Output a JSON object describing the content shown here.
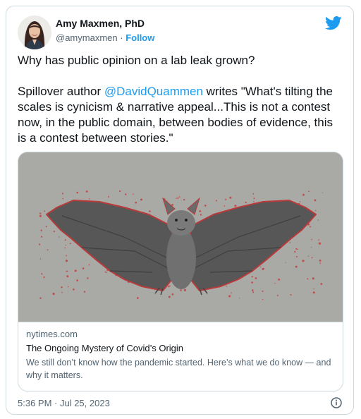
{
  "author": {
    "name": "Amy Maxmen, PhD",
    "handle": "@amymaxmen",
    "separator": "·",
    "follow_label": "Follow"
  },
  "tweet": {
    "line1": "Why has public opinion on a lab leak grown?",
    "prefix": "Spillover author ",
    "mention": "@DavidQuammen",
    "quote": " writes \"What's tilting the scales is cynicism & narrative appeal...This is not a contest now, in the public domain, between bodies of evidence, this is a contest between stories.\""
  },
  "link_card": {
    "domain": "nytimes.com",
    "title": "The Ongoing Mystery of Covid’s Origin",
    "description": "We still don’t know how the pandemic started. Here’s what we do know — and why it matters."
  },
  "timestamp": "5:36 PM · Jul 25, 2023",
  "icons": {
    "brand": "twitter-bird-icon",
    "info": "info-icon"
  },
  "colors": {
    "accent": "#1d9bf0",
    "text": "#0f1419",
    "muted": "#536471",
    "border": "#cfd9de"
  }
}
